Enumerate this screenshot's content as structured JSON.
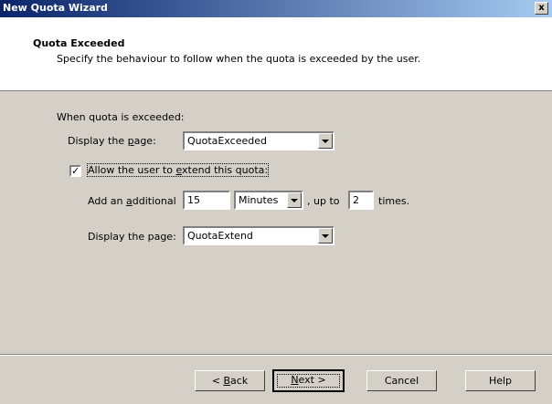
{
  "window": {
    "title": "New Quota Wizard",
    "close_glyph": "x"
  },
  "header": {
    "title": "Quota Exceeded",
    "subtitle": "Specify the behaviour to follow when the quota is exceeded by the user."
  },
  "form": {
    "section_label": "When quota is exceeded:",
    "display_page": {
      "label_pre": "Display the ",
      "label_key": "p",
      "label_post": "age:",
      "value": "QuotaExceeded"
    },
    "allow_extend": {
      "checked": true,
      "check_glyph": "✓",
      "label_pre": "Allow the user to ",
      "label_key": "e",
      "label_post": "xtend this quota:"
    },
    "add_additional": {
      "label_pre": "Add an ",
      "label_key": "a",
      "label_post": "dditional",
      "amount": "15",
      "unit": "Minutes",
      "up_to_label": ", up to",
      "times_value": "2",
      "times_label": "times."
    },
    "extend_page": {
      "label": "Display the page:",
      "value": "QuotaExtend"
    }
  },
  "buttons": {
    "back": {
      "pre": "< ",
      "key": "B",
      "post": "ack"
    },
    "next": {
      "pre": "",
      "key": "N",
      "post": "ext >"
    },
    "cancel": "Cancel",
    "help": "Help"
  },
  "colors": {
    "title_gradient_start": "#0a246a",
    "title_gradient_end": "#a6caf0",
    "face": "#d4d0c8"
  }
}
